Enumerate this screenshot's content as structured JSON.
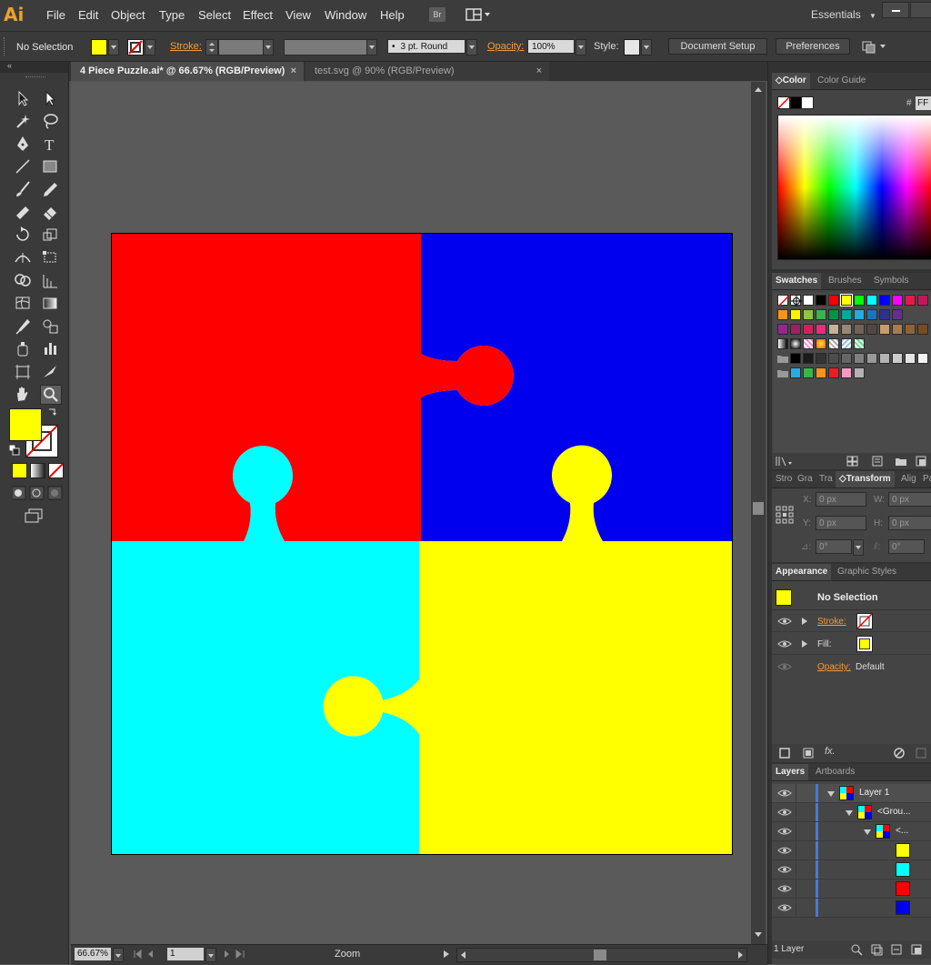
{
  "app": {
    "logo": "Ai"
  },
  "menu": [
    "File",
    "Edit",
    "Object",
    "Type",
    "Select",
    "Effect",
    "View",
    "Window",
    "Help"
  ],
  "menubar": {
    "bridge": "Br",
    "workspace": "Essentials"
  },
  "control": {
    "selection": "No Selection",
    "fill_color": "#ffff00",
    "stroke_label": "Stroke:",
    "brush": "3 pt. Round",
    "opacity_label": "Opacity:",
    "opacity": "100%",
    "style_label": "Style:",
    "doc_setup": "Document Setup",
    "preferences": "Preferences"
  },
  "tabs": [
    {
      "label": "4 Piece Puzzle.ai* @ 66.67% (RGB/Preview)",
      "close": "×"
    },
    {
      "label": "test.svg @ 90% (RGB/Preview)",
      "close": "×"
    }
  ],
  "artwork": {
    "colors": {
      "red": "#ff0000",
      "blue": "#0000ee",
      "cyan": "#00ffff",
      "yellow": "#ffff00"
    }
  },
  "status": {
    "zoom": "66.67%",
    "page": "1",
    "tool": "Zoom"
  },
  "color_panel": {
    "tabs": [
      "Color",
      "Color Guide"
    ],
    "hash": "#",
    "hex": "FF"
  },
  "swatches_panel": {
    "tabs": [
      "Swatches",
      "Brushes",
      "Symbols"
    ],
    "row1": [
      "#ff0000",
      "#ffff00",
      "#00ff00",
      "#00ffff",
      "#0000ff",
      "#ff00ff",
      "#e6194b",
      "#c2185b"
    ],
    "row2": [
      "#f7941d",
      "#fff200",
      "#8dc63f",
      "#39b54a",
      "#009444",
      "#00a99d",
      "#27aae1",
      "#1c75bc",
      "#2e3192",
      "#662d91"
    ],
    "row3": [
      "#92278f",
      "#9e1f63",
      "#da1c5c",
      "#ee2a7b",
      "#c7b299",
      "#998675",
      "#736357",
      "#534741",
      "#c69c6d",
      "#a67c52",
      "#8c6239",
      "#754c24"
    ],
    "row5": [
      "#000000",
      "#1a1a1a",
      "#333333",
      "#4d4d4d",
      "#666666",
      "#808080",
      "#999999",
      "#b3b3b3",
      "#cccccc",
      "#e6e6e6",
      "#f2f2f2"
    ],
    "row6": [
      "#29abe2",
      "#39b54a",
      "#f7931e",
      "#ed1c24",
      "#f49ac1",
      "#b3b3b3"
    ]
  },
  "transform_panel": {
    "tabs": [
      "Stro",
      "Gra",
      "Tra",
      "Transform",
      "Alig",
      "Pa"
    ],
    "x_label": "X:",
    "x": "0 px",
    "y_label": "Y:",
    "y": "0 px",
    "w_label": "W:",
    "w": "0 px",
    "h_label": "H:",
    "h": "0 px",
    "rotate_label": "⊿:",
    "rotate": "0°",
    "shear_label": "⫽:",
    "shear": "0°"
  },
  "appearance_panel": {
    "tabs": [
      "Appearance",
      "Graphic Styles"
    ],
    "title": "No Selection",
    "stroke_label": "Stroke:",
    "fill_label": "Fill:",
    "opacity_label": "Opacity:",
    "opacity_value": "Default",
    "fx": "fx."
  },
  "layers_panel": {
    "tabs": [
      "Layers",
      "Artboards"
    ],
    "rows": [
      {
        "label": "Layer 1"
      },
      {
        "label": "<Grou..."
      },
      {
        "label": "<..."
      },
      {
        "label": ""
      },
      {
        "label": ""
      },
      {
        "label": ""
      },
      {
        "label": ""
      }
    ],
    "footer": "1 Layer"
  }
}
